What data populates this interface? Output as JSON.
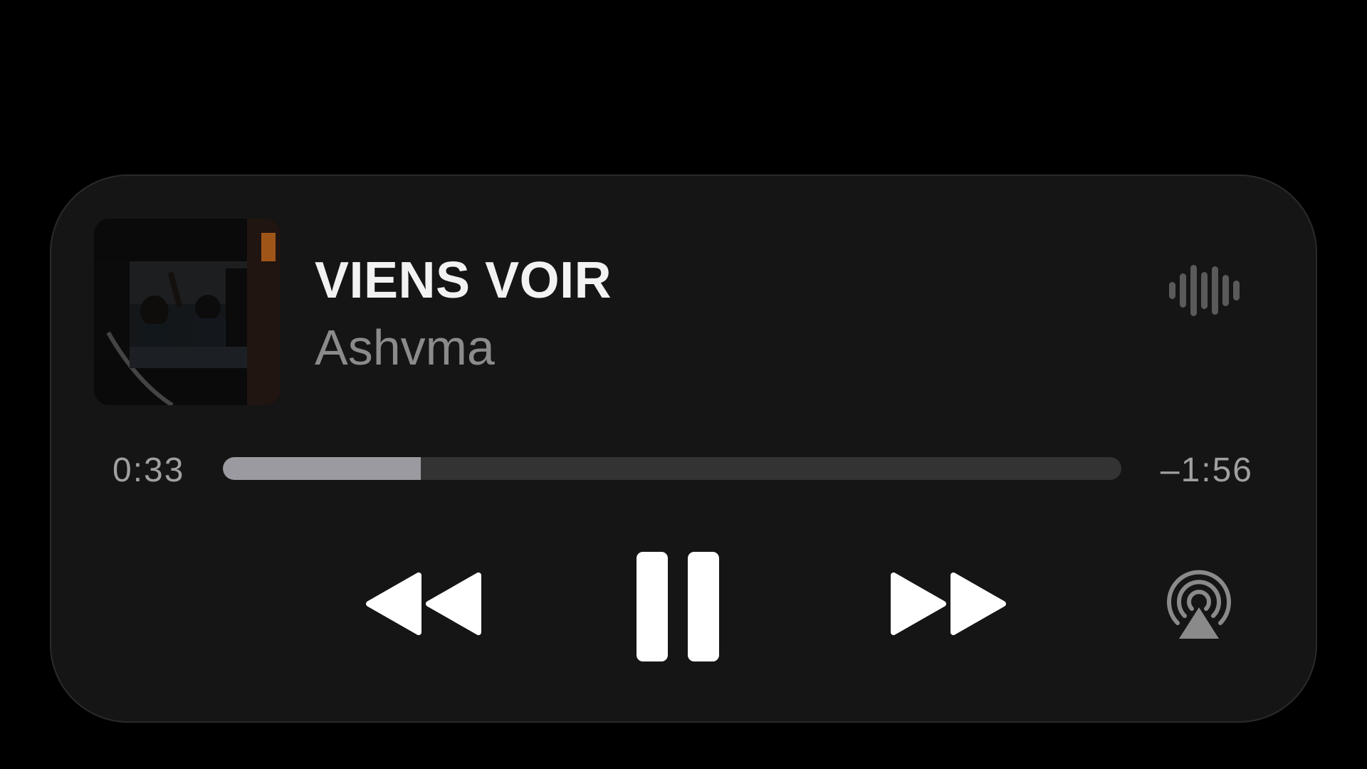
{
  "now_playing": {
    "title": "VIENS VOIR",
    "artist": "Ashvma",
    "artwork_icon": "album-artwork"
  },
  "progress": {
    "elapsed": "0:33",
    "remaining": "–1:56",
    "fraction": 0.22
  },
  "controls": {
    "rewind_icon": "rewind-icon",
    "pause_icon": "pause-icon",
    "forward_icon": "fast-forward-icon",
    "airplay_icon": "airplay-icon",
    "waveform_icon": "waveform-icon"
  },
  "colors": {
    "background": "#000000",
    "panel": "#151515",
    "title": "#f2f2f2",
    "artist": "#8b8b8b",
    "track": "#333333",
    "fill": "#9a9aa0"
  }
}
